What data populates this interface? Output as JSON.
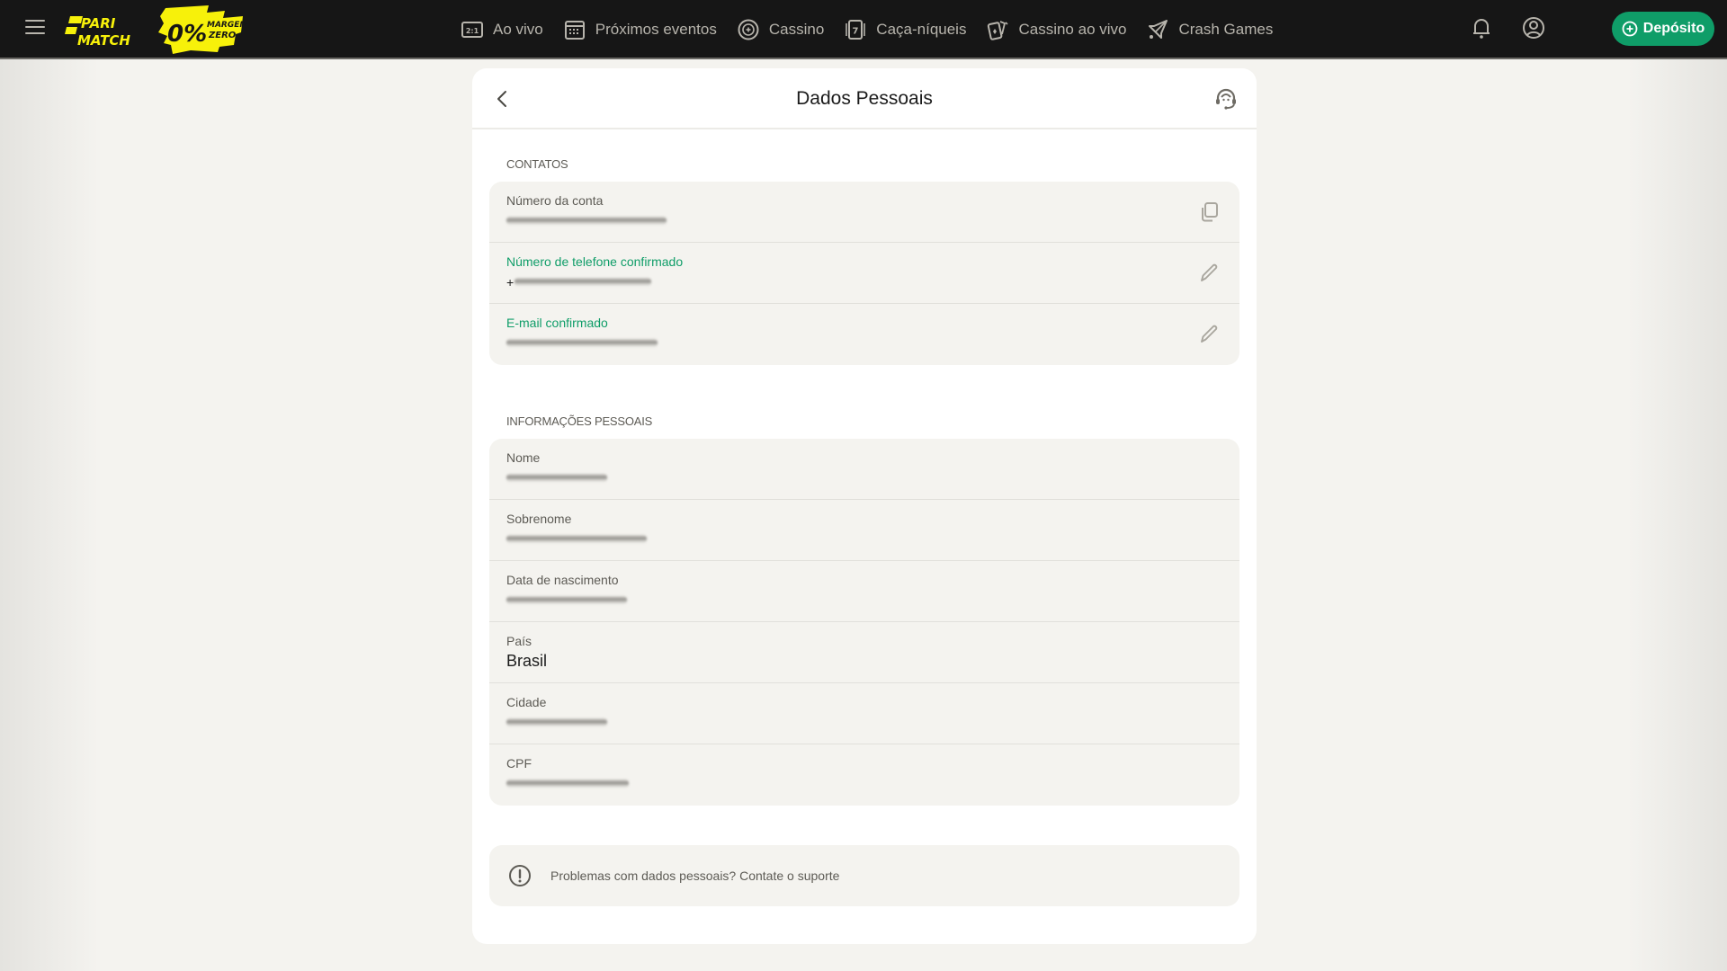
{
  "header": {
    "logo": {
      "line1": "PARI",
      "line2": "MATCH",
      "promo_big": "0%",
      "promo_line1": "MARGEM",
      "promo_line2": "ZERO"
    },
    "nav": [
      {
        "label": "Ao vivo",
        "icon": "live-score-icon"
      },
      {
        "label": "Próximos eventos",
        "icon": "calendar-icon"
      },
      {
        "label": "Cassino",
        "icon": "casino-chip-icon"
      },
      {
        "label": "Caça-níqueis",
        "icon": "slot-machine-icon"
      },
      {
        "label": "Cassino ao vivo",
        "icon": "playing-cards-icon"
      },
      {
        "label": "Crash Games",
        "icon": "rocket-icon"
      }
    ],
    "deposit_label": "Depósito"
  },
  "colors": {
    "accent": "#0f9d68",
    "brand_yellow": "#f7f10a",
    "header_bg": "#161616"
  },
  "page": {
    "title": "Dados Pessoais",
    "contacts": {
      "heading": "CONTATOS",
      "rows": [
        {
          "label": "Número da conta",
          "value": "[redacted]",
          "action": "copy"
        },
        {
          "label": "Número de telefone confirmado",
          "value_prefix": "+",
          "value": "[redacted]",
          "action": "edit"
        },
        {
          "label": "E-mail confirmado",
          "value": "[redacted]",
          "action": "edit"
        }
      ]
    },
    "personal": {
      "heading": "INFORMAÇÕES PESSOAIS",
      "rows": [
        {
          "label": "Nome",
          "value": "[redacted]"
        },
        {
          "label": "Sobrenome",
          "value": "[redacted]"
        },
        {
          "label": "Data de nascimento",
          "value": "[redacted]"
        },
        {
          "label": "País",
          "value": "Brasil"
        },
        {
          "label": "Cidade",
          "value": "[redacted]"
        },
        {
          "label": "CPF",
          "value": "[redacted]"
        }
      ]
    },
    "notice": "Problemas com dados pessoais? Contate o suporte"
  }
}
